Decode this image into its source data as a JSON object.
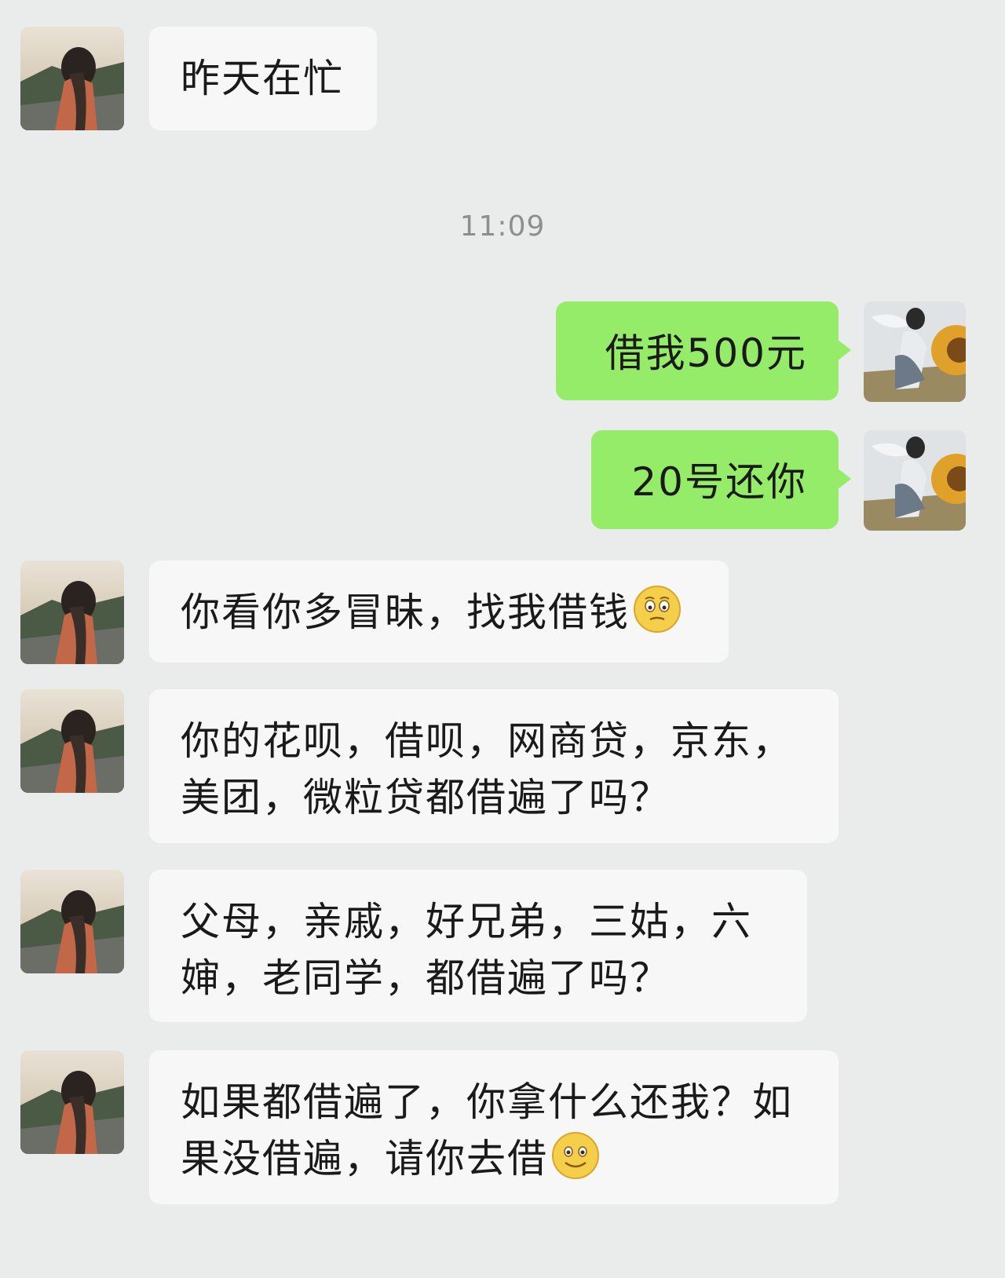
{
  "chat": {
    "timestamp": "11:09",
    "messages": [
      {
        "side": "in",
        "text": "昨天在忙"
      },
      {
        "side": "out",
        "text": "借我500元"
      },
      {
        "side": "out",
        "text": "20号还你"
      },
      {
        "side": "in",
        "text": "你看你多冒昧，找我借钱",
        "emoji": "awkward-face-icon"
      },
      {
        "side": "in",
        "line1": "你的花呗，借呗，网商贷，京东，",
        "line2": "美团，微粒贷都借遍了吗？"
      },
      {
        "side": "in",
        "line1": "父母，亲戚，好兄弟，三姑，六",
        "line2": "婶，老同学，都借遍了吗？"
      },
      {
        "side": "in",
        "line1": "如果都借遍了，你拿什么还我？如",
        "line2": "果没借遍，请你去借",
        "emoji": "smile-face-icon"
      }
    ]
  },
  "colors": {
    "background": "#e9eceb",
    "incoming_bubble": "#f7f7f7",
    "outgoing_bubble": "#95ec69",
    "timestamp": "#8e8e8e"
  }
}
